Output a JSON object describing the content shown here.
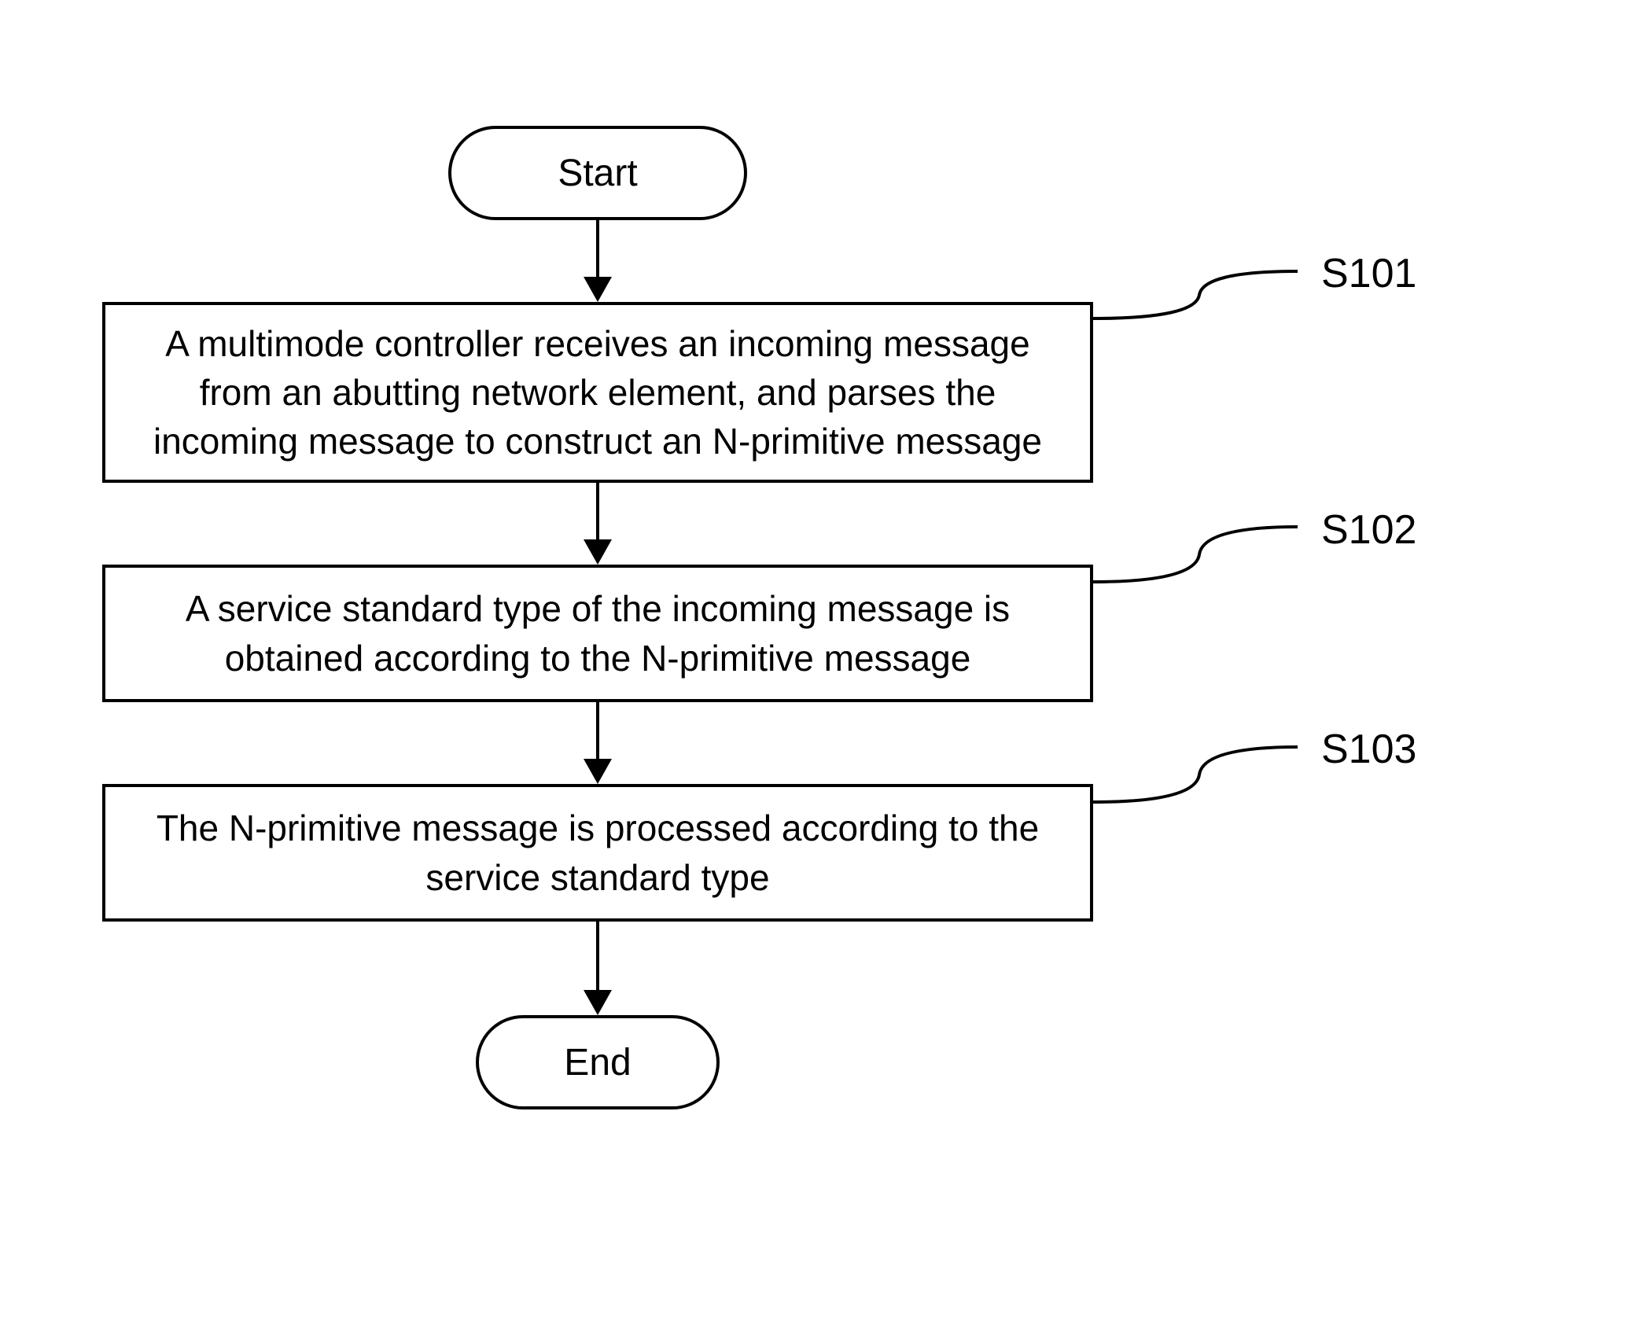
{
  "flowchart": {
    "start": "Start",
    "end": "End",
    "steps": {
      "s101": {
        "label": "S101",
        "text": "A multimode controller receives an incoming message from an abutting network element, and parses the incoming message to construct an N-primitive message"
      },
      "s102": {
        "label": "S102",
        "text": "A service standard type of the incoming message is obtained according to the N-primitive message"
      },
      "s103": {
        "label": "S103",
        "text": "The N-primitive message is processed according to the service standard type"
      }
    }
  }
}
